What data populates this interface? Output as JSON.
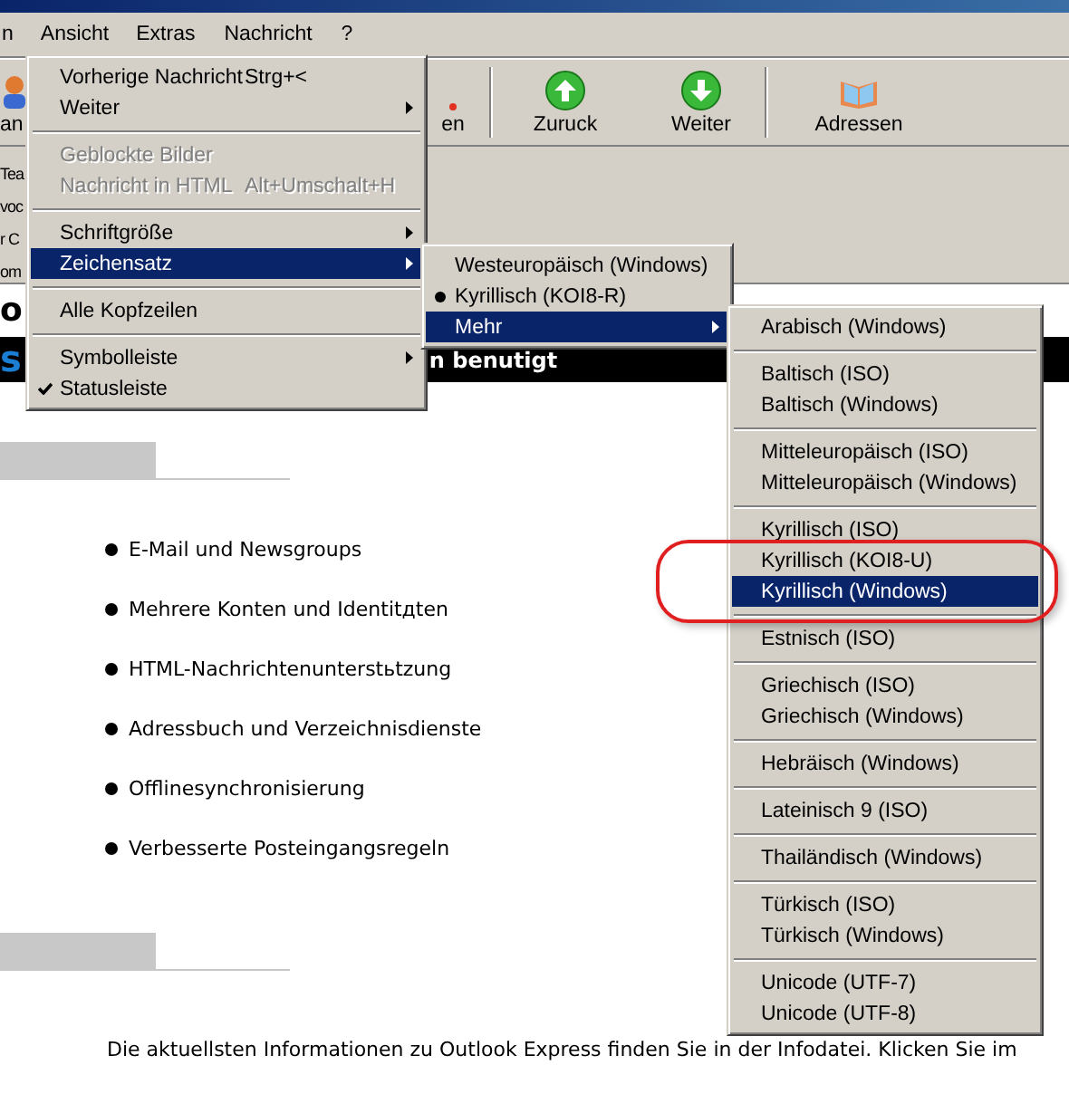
{
  "menubar": [
    {
      "label": "n",
      "selected": false
    },
    {
      "label": "Ansicht",
      "selected": true
    },
    {
      "label": "Extras",
      "selected": false
    },
    {
      "label": "Nachricht",
      "selected": false
    },
    {
      "label": "?",
      "selected": false
    }
  ],
  "toolbar": [
    {
      "label": "an",
      "kind": "contacts"
    },
    {
      "label": "en",
      "kind": "partial"
    },
    {
      "label": "Zuruck",
      "kind": "up"
    },
    {
      "label": "Weiter",
      "kind": "down"
    },
    {
      "label": "Adressen",
      "kind": "book"
    }
  ],
  "left_panel": [
    "Tea",
    "voc",
    "r C",
    "om"
  ],
  "banner": {
    "logo_top": "o",
    "logo_bottom": "s",
    "text": "n benutigt"
  },
  "features": [
    "E-Mail und Newsgroups",
    "Mehrere Konten und Identitдten",
    "HTML-Nachrichtenunterstьtzung",
    "Adressbuch und Verzeichnisdienste",
    "Offlinesynchronisierung",
    "Verbesserte Posteingangsregeln"
  ],
  "info_text": "Die aktuellsten Informationen zu Outlook Express finden Sie in der Infodatei. Klicken Sie im",
  "view_menu": [
    {
      "kind": "command",
      "label": "Vorherige Nachricht",
      "shortcut": "Strg+<",
      "disabled": false,
      "submenu": false,
      "selected": false
    },
    {
      "kind": "command",
      "label": "Weiter",
      "disabled": false,
      "submenu": true,
      "selected": false
    },
    {
      "kind": "separator"
    },
    {
      "kind": "command",
      "label": "Geblockte Bilder",
      "disabled": true,
      "submenu": false,
      "selected": false
    },
    {
      "kind": "command",
      "label": "Nachricht in HTML",
      "shortcut": "Alt+Umschalt+H",
      "disabled": true,
      "submenu": false,
      "selected": false
    },
    {
      "kind": "separator"
    },
    {
      "kind": "command",
      "label": "Schriftgröße",
      "disabled": false,
      "submenu": true,
      "selected": false
    },
    {
      "kind": "command",
      "label": "Zeichensatz",
      "disabled": false,
      "submenu": true,
      "selected": true
    },
    {
      "kind": "separator"
    },
    {
      "kind": "command",
      "label": "Alle Kopfzeilen",
      "disabled": false,
      "submenu": false,
      "selected": false
    },
    {
      "kind": "separator"
    },
    {
      "kind": "command",
      "label": "Symbolleiste",
      "disabled": false,
      "submenu": true,
      "selected": false
    },
    {
      "kind": "check",
      "label": "Statusleiste",
      "checked": true,
      "disabled": false,
      "submenu": false,
      "selected": false
    }
  ],
  "charset_menu": [
    {
      "kind": "radio",
      "label": "Westeuropäisch (Windows)",
      "checked": false,
      "submenu": false,
      "selected": false
    },
    {
      "kind": "radio",
      "label": "Kyrillisch (KOI8-R)",
      "checked": true,
      "submenu": false,
      "selected": false
    },
    {
      "kind": "command",
      "label": "Mehr",
      "submenu": true,
      "selected": true
    }
  ],
  "more_menu": [
    {
      "kind": "command",
      "label": "Arabisch (Windows)",
      "selected": false
    },
    {
      "kind": "separator"
    },
    {
      "kind": "command",
      "label": "Baltisch (ISO)",
      "selected": false
    },
    {
      "kind": "command",
      "label": "Baltisch (Windows)",
      "selected": false
    },
    {
      "kind": "separator"
    },
    {
      "kind": "command",
      "label": "Mitteleuropäisch (ISO)",
      "selected": false
    },
    {
      "kind": "command",
      "label": "Mitteleuropäisch (Windows)",
      "selected": false
    },
    {
      "kind": "separator"
    },
    {
      "kind": "command",
      "label": "Kyrillisch (ISO)",
      "selected": false
    },
    {
      "kind": "command",
      "label": "Kyrillisch (KOI8-U)",
      "selected": false
    },
    {
      "kind": "command",
      "label": "Kyrillisch (Windows)",
      "selected": true
    },
    {
      "kind": "separator"
    },
    {
      "kind": "command",
      "label": "Estnisch (ISO)",
      "selected": false
    },
    {
      "kind": "separator"
    },
    {
      "kind": "command",
      "label": "Griechisch (ISO)",
      "selected": false
    },
    {
      "kind": "command",
      "label": "Griechisch (Windows)",
      "selected": false
    },
    {
      "kind": "separator"
    },
    {
      "kind": "command",
      "label": "Hebräisch (Windows)",
      "selected": false
    },
    {
      "kind": "separator"
    },
    {
      "kind": "command",
      "label": "Lateinisch 9 (ISO)",
      "selected": false
    },
    {
      "kind": "separator"
    },
    {
      "kind": "command",
      "label": "Thailändisch (Windows)",
      "selected": false
    },
    {
      "kind": "separator"
    },
    {
      "kind": "command",
      "label": "Türkisch (ISO)",
      "selected": false
    },
    {
      "kind": "command",
      "label": "Türkisch (Windows)",
      "selected": false
    },
    {
      "kind": "separator"
    },
    {
      "kind": "command",
      "label": "Unicode (UTF-7)",
      "selected": false
    },
    {
      "kind": "command",
      "label": "Unicode (UTF-8)",
      "selected": false
    }
  ]
}
